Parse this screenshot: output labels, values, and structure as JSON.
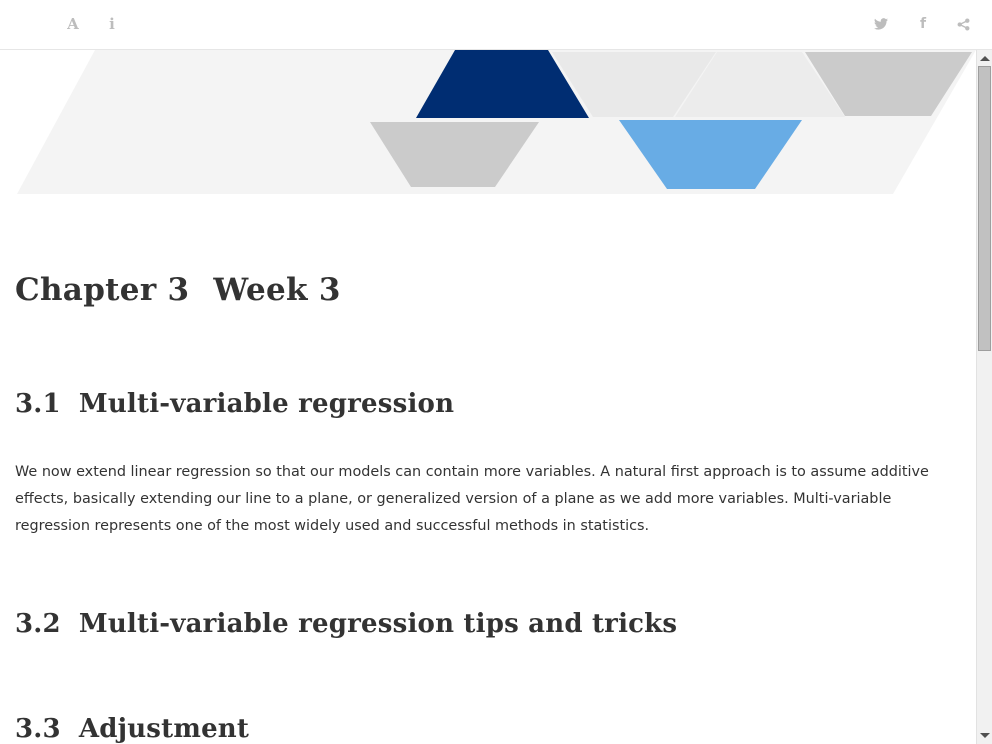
{
  "toolbar": {
    "left": [
      {
        "icon": "font-settings-icon",
        "glyph": "A",
        "label": "Font settings"
      },
      {
        "icon": "info-icon",
        "glyph": "i",
        "label": "Information"
      }
    ],
    "right": [
      {
        "icon": "twitter-icon",
        "label": "Share on Twitter"
      },
      {
        "icon": "facebook-icon",
        "glyph": "f",
        "label": "Share on Facebook"
      },
      {
        "icon": "share-icon",
        "label": "Share"
      }
    ]
  },
  "banner": {
    "colors": {
      "background_band": "#f4f4f4",
      "dark_blue": "#002d72",
      "light_blue": "#68ace5",
      "grey": "#cbcbcb",
      "light_grey": "#e9e9e9"
    }
  },
  "chapter": {
    "number": "Chapter 3",
    "title": "Week 3"
  },
  "sections": [
    {
      "number": "3.1",
      "title": "Multi-variable regression",
      "body": "We now extend linear regression so that our models can contain more variables. A natural first approach is to assume additive effects, basically extending our line to a plane, or generalized version of a plane as we add more variables. Multi-variable regression represents one of the most widely used and successful methods in statistics."
    },
    {
      "number": "3.2",
      "title": "Multi-variable regression tips and tricks"
    },
    {
      "number": "3.3",
      "title": "Adjustment"
    }
  ],
  "colors": {
    "text": "#333333",
    "icon": "#bdbdbd",
    "scrollbar_thumb": "#c1c1c1"
  }
}
